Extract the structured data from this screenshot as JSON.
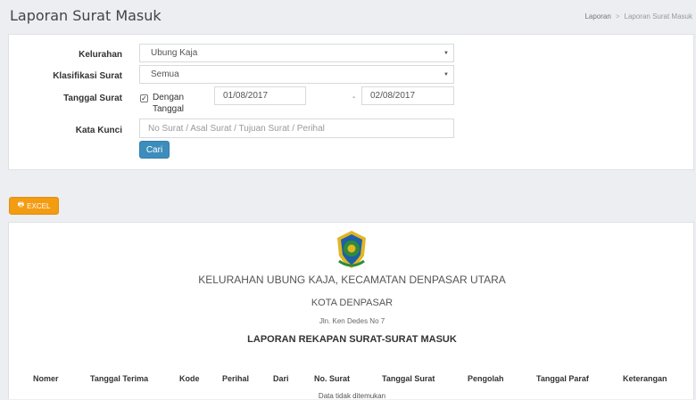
{
  "header": {
    "title": "Laporan Surat Masuk",
    "breadcrumb": [
      "Laporan",
      "Laporan Surat Masuk"
    ]
  },
  "filter": {
    "kelurahan": {
      "label": "Kelurahan",
      "value": "Ubung Kaja"
    },
    "klasifikasi": {
      "label": "Klasifikasi Surat",
      "value": "Semua"
    },
    "tanggal": {
      "label": "Tanggal Surat",
      "checkbox_label": "Dengan Tanggal",
      "checked": true,
      "from": "01/08/2017",
      "separator": "-",
      "to": "02/08/2017"
    },
    "kata_kunci": {
      "label": "Kata Kunci",
      "placeholder": "No Surat / Asal Surat / Tujuan Surat / Perihal",
      "value": ""
    },
    "search_button": "Cari"
  },
  "actions": {
    "excel_label": "EXCEL"
  },
  "report": {
    "title": "KELURAHAN UBUNG KAJA, KECAMATAN DENPASAR UTARA",
    "city": "KOTA DENPASAR",
    "address": "Jln. Ken Dedes No 7",
    "heading": "LAPORAN REKAPAN SURAT-SURAT MASUK",
    "columns": [
      "Nomer",
      "Tanggal Terima",
      "Kode",
      "Perihal",
      "Dari",
      "No. Surat",
      "Tanggal Surat",
      "Pengolah",
      "Tanggal Paraf",
      "Keterangan"
    ],
    "empty_message": "Data tidak ditemukan"
  },
  "colors": {
    "primary": "#3c8dbc",
    "warning": "#f39c12",
    "background": "#eceef2",
    "logo_blue": "#1f5ea8",
    "logo_green": "#2e8b3a",
    "logo_gold": "#e2b623"
  },
  "icons": {
    "printer": "printer-icon",
    "caret": "caret-down-icon",
    "logo": "government-emblem"
  }
}
